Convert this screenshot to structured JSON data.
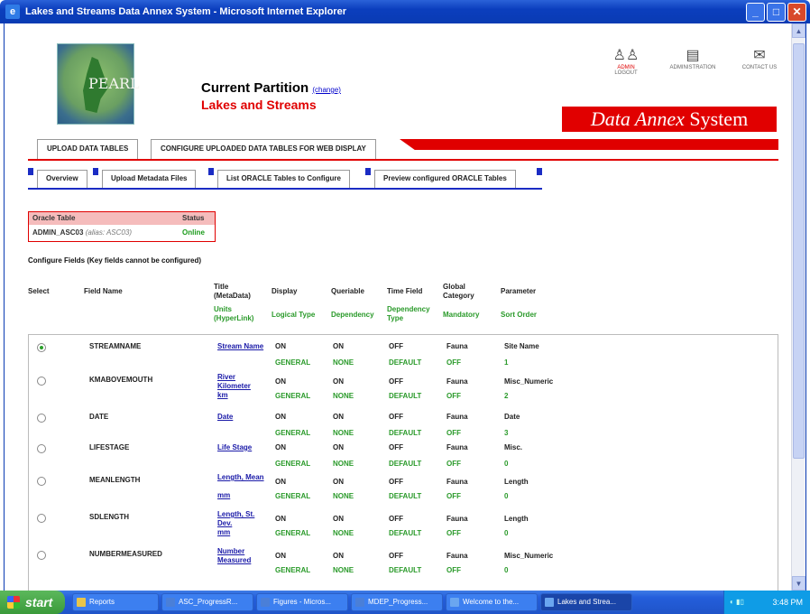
{
  "window": {
    "title": "Lakes and Streams Data Annex System - Microsoft Internet Explorer"
  },
  "header": {
    "logo_text": "PEARL",
    "current_partition_label": "Current Partition",
    "change_link": "(change)",
    "partition_name": "Lakes and Streams",
    "banner": {
      "part1": "Data Annex",
      "part2": "System"
    },
    "icons": [
      {
        "label1": "ADMIN",
        "label2": "LOGOUT"
      },
      {
        "label1": "ADMINISTRATION",
        "label2": ""
      },
      {
        "label1": "CONTACT US",
        "label2": ""
      }
    ]
  },
  "main_tabs": [
    "UPLOAD DATA TABLES",
    "CONFIGURE UPLOADED DATA TABLES FOR WEB DISPLAY"
  ],
  "sub_tabs": [
    "Overview",
    "Upload Metadata Files",
    "List ORACLE Tables to Configure",
    "Preview configured ORACLE Tables"
  ],
  "oracle_table": {
    "header_table": "Oracle Table",
    "header_status": "Status",
    "name": "ADMIN_ASC03",
    "alias": "(alias: ASC03)",
    "status": "Online"
  },
  "configure_title": "Configure Fields (Key fields cannot be configured)",
  "columns": {
    "select": "Select",
    "field_name": "Field Name",
    "title": "Title (MetaData)",
    "units": "Units (HyperLink)",
    "display": "Display",
    "logical_type": "Logical Type",
    "queriable": "Queriable",
    "dependency": "Dependency",
    "time_field": "Time Field",
    "dependency_type": "Dependency Type",
    "global_category": "Global Category",
    "mandatory": "Mandatory",
    "parameter": "Parameter",
    "sort_order": "Sort Order"
  },
  "rows": [
    {
      "selected": true,
      "field": "STREAMNAME",
      "title": "Stream Name",
      "units": "",
      "display": "ON",
      "queriable": "ON",
      "time": "OFF",
      "category": "Fauna",
      "parameter": "Site Name",
      "logical": "GENERAL",
      "dependency": "NONE",
      "dep_type": "DEFAULT",
      "mandatory": "OFF",
      "sort": "1"
    },
    {
      "selected": false,
      "field": "KMABOVEMOUTH",
      "title": "River Kilometer",
      "units": "km",
      "display": "ON",
      "queriable": "ON",
      "time": "OFF",
      "category": "Fauna",
      "parameter": "Misc_Numeric",
      "logical": "GENERAL",
      "dependency": "NONE",
      "dep_type": "DEFAULT",
      "mandatory": "OFF",
      "sort": "2"
    },
    {
      "selected": false,
      "field": "DATE",
      "title": "Date",
      "units": "",
      "display": "ON",
      "queriable": "ON",
      "time": "OFF",
      "category": "Fauna",
      "parameter": "Date",
      "logical": "GENERAL",
      "dependency": "NONE",
      "dep_type": "DEFAULT",
      "mandatory": "OFF",
      "sort": "3"
    },
    {
      "selected": false,
      "field": "LIFESTAGE",
      "title": "Life Stage",
      "units": "",
      "display": "ON",
      "queriable": "ON",
      "time": "OFF",
      "category": "Fauna",
      "parameter": "Misc.",
      "logical": "GENERAL",
      "dependency": "NONE",
      "dep_type": "DEFAULT",
      "mandatory": "OFF",
      "sort": "0"
    },
    {
      "selected": false,
      "field": "MEANLENGTH",
      "title": "Length, Mean",
      "units": "mm",
      "display": "ON",
      "queriable": "ON",
      "time": "OFF",
      "category": "Fauna",
      "parameter": "Length",
      "logical": "GENERAL",
      "dependency": "NONE",
      "dep_type": "DEFAULT",
      "mandatory": "OFF",
      "sort": "0"
    },
    {
      "selected": false,
      "field": "SDLENGTH",
      "title": "Length, St. Dev.",
      "units": "mm",
      "display": "ON",
      "queriable": "ON",
      "time": "OFF",
      "category": "Fauna",
      "parameter": "Length",
      "logical": "GENERAL",
      "dependency": "NONE",
      "dep_type": "DEFAULT",
      "mandatory": "OFF",
      "sort": "0"
    },
    {
      "selected": false,
      "field": "NUMBERMEASURED",
      "title": "Number Measured",
      "units": "",
      "display": "ON",
      "queriable": "ON",
      "time": "OFF",
      "category": "Fauna",
      "parameter": "Misc_Numeric",
      "logical": "GENERAL",
      "dependency": "NONE",
      "dep_type": "DEFAULT",
      "mandatory": "OFF",
      "sort": "0"
    }
  ],
  "taskbar": {
    "start": "start",
    "items": [
      "Reports",
      "ASC_ProgressR...",
      "Figures - Micros...",
      "MDEP_Progress...",
      "Welcome to the...",
      "Lakes and Strea..."
    ],
    "clock": "3:48 PM"
  },
  "colors": {
    "accent_red": "#e00000",
    "tab_blue": "#1b2cc4",
    "green_text": "#2a9a2a",
    "link_blue": "#1a1aa8"
  }
}
